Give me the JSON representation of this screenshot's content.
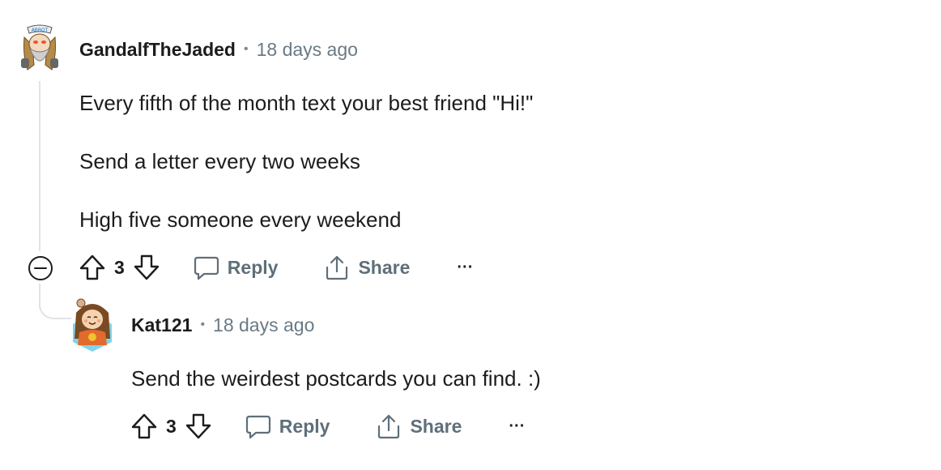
{
  "comments": [
    {
      "username": "GandalfTheJaded",
      "separator": "•",
      "timestamp": "18 days ago",
      "avatar_badge": "ABBOT",
      "paragraphs": [
        "Every fifth of the month text your best friend \"Hi!\"",
        "Send a letter every two weeks",
        "High five someone every weekend"
      ],
      "vote_count": "3",
      "reply_label": "Reply",
      "share_label": "Share",
      "more_label": "···"
    },
    {
      "username": "Kat121",
      "separator": "•",
      "timestamp": "18 days ago",
      "paragraphs": [
        "Send the weirdest postcards you can find. :)"
      ],
      "vote_count": "3",
      "reply_label": "Reply",
      "share_label": "Share",
      "more_label": "···"
    }
  ],
  "colors": {
    "text": "#1c1c1c",
    "muted": "#6a7a85",
    "icon": "#5f6f7a",
    "thread_line": "#dfe3e6"
  },
  "icons": {
    "collapse": "minus-circle-icon",
    "upvote": "arrow-up-icon",
    "downvote": "arrow-down-icon",
    "reply": "speech-bubble-icon",
    "share": "share-icon",
    "more": "ellipsis-icon"
  }
}
